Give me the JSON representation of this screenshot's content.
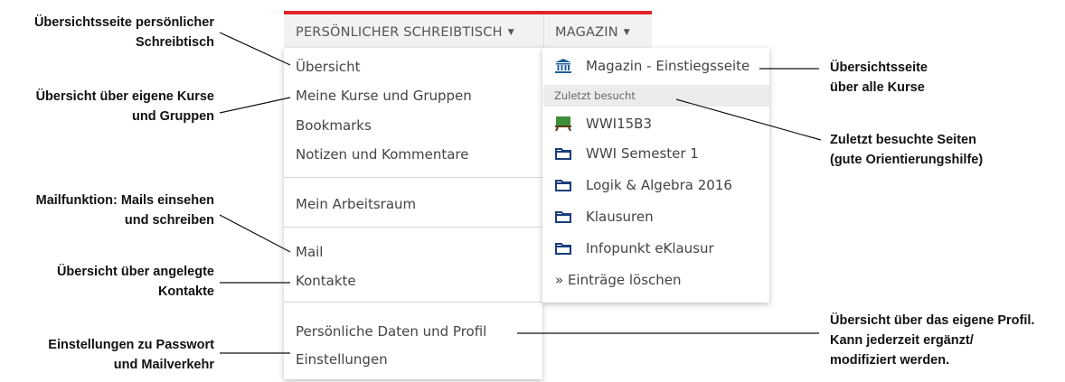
{
  "nav": {
    "tab_desk": "PERSÖNLICHER SCHREIBTISCH",
    "tab_magazin": "MAGAZIN",
    "caret": "▼",
    "accent_color": "#e2232a"
  },
  "desk_menu": {
    "overview": "Übersicht",
    "courses": "Meine Kurse und Gruppen",
    "bookmarks": "Bookmarks",
    "notes": "Notizen und Kommentare",
    "workspace": "Mein Arbeitsraum",
    "mail": "Mail",
    "contacts": "Kontakte",
    "profile": "Persönliche Daten und Profil",
    "settings": "Einstellungen"
  },
  "mag_menu": {
    "entry": {
      "label": "Magazin - Einstiegsseite",
      "icon": "institution-icon"
    },
    "recent_header": "Zuletzt besucht",
    "recent": [
      {
        "label": "WWI15B3",
        "icon": "classroom-icon"
      },
      {
        "label": "WWI Semester 1",
        "icon": "folder-icon"
      },
      {
        "label": "Logik & Algebra 2016",
        "icon": "folder-icon"
      },
      {
        "label": "Klausuren",
        "icon": "folder-icon"
      },
      {
        "label": "Infopunkt eKlausur",
        "icon": "folder-icon"
      }
    ],
    "clear": "» Einträge löschen"
  },
  "annotations": {
    "a1_l1": "Übersichtsseite persönlicher",
    "a1_l2": "Schreibtisch",
    "a2_l1": "Übersicht über eigene Kurse",
    "a2_l2": "und Gruppen",
    "a3_l1": "Mailfunktion: Mails einsehen",
    "a3_l2": "und schreiben",
    "a4_l1": "Übersicht über angelegte",
    "a4_l2": "Kontakte",
    "a5_l1": "Einstellungen zu Passwort",
    "a5_l2": "und Mailverkehr",
    "a6_l1": "Übersichtsseite",
    "a6_l2": "über alle Kurse",
    "a7_l1": "Zuletzt besuchte Seiten",
    "a7_l2": "(gute Orientierungshilfe)",
    "a8_l1": "Übersicht über das eigene Profil.",
    "a8_l2": "Kann jederzeit ergänzt/",
    "a8_l3": "modifiziert werden."
  }
}
